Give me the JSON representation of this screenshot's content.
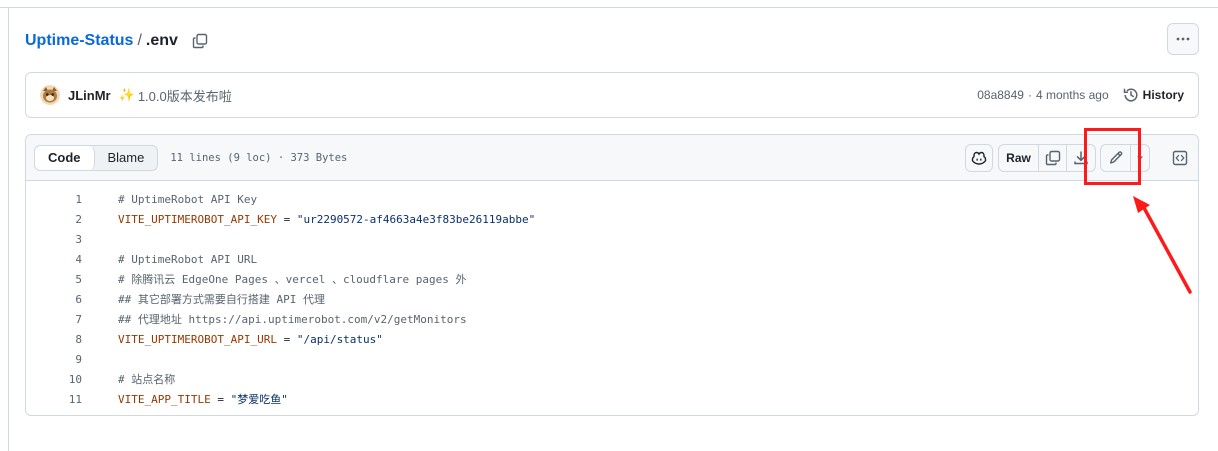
{
  "breadcrumb": {
    "repo": "Uptime-Status",
    "separator": "/",
    "file": ".env"
  },
  "commit": {
    "author": "JLinMr",
    "sparkle": "✨",
    "message": "1.0.0版本发布啦",
    "sha": "08a8849",
    "dot": "·",
    "time": "4 months ago",
    "history_label": "History"
  },
  "file_header": {
    "tabs": [
      "Code",
      "Blame"
    ],
    "active_tab": "Code",
    "info": "11 lines (9 loc) · 373 Bytes",
    "raw_label": "Raw"
  },
  "code_lines": [
    {
      "n": "1",
      "text": "# UptimeRobot API Key"
    },
    {
      "n": "2",
      "text": "VITE_UPTIMEROBOT_API_KEY = \"ur2290572-af4663a4e3f83be26119abbe\""
    },
    {
      "n": "3",
      "text": ""
    },
    {
      "n": "4",
      "text": "# UptimeRobot API URL"
    },
    {
      "n": "5",
      "text": "# 除腾讯云 EdgeOne Pages 、vercel 、cloudflare pages 外"
    },
    {
      "n": "6",
      "text": "## 其它部署方式需要自行搭建 API 代理"
    },
    {
      "n": "7",
      "text": "## 代理地址 https://api.uptimerobot.com/v2/getMonitors"
    },
    {
      "n": "8",
      "text": "VITE_UPTIMEROBOT_API_URL = \"/api/status\""
    },
    {
      "n": "9",
      "text": ""
    },
    {
      "n": "10",
      "text": "# 站点名称"
    },
    {
      "n": "11",
      "text": "VITE_APP_TITLE = \"梦爱吃鱼\""
    }
  ],
  "colors": {
    "link": "#0969da",
    "annotation": "#ff1a1a",
    "env_key": "#953800",
    "string": "#0a3069",
    "comment": "#59636e"
  },
  "icons": [
    "copy-icon",
    "kebab-icon",
    "history-icon",
    "copilot-icon",
    "download-icon",
    "pencil-icon",
    "triangle-down-icon",
    "code-square-icon"
  ]
}
